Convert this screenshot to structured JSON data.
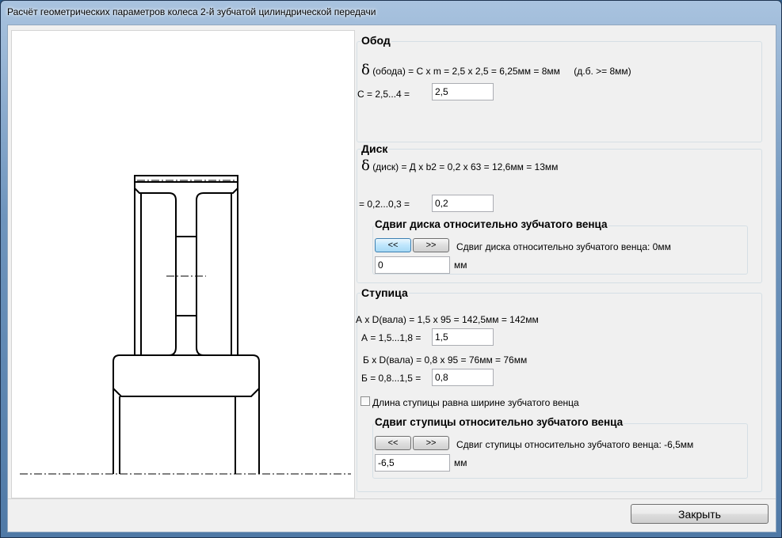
{
  "window": {
    "title": "Расчёт геометрических параметров колеса 2-й зубчатой цилиндрической передачи"
  },
  "rim": {
    "title": "Обод",
    "delta_symbol": "δ",
    "formula": "(обода) = С х m = 2,5 х 2,5 = 6,25мм = 8мм",
    "note": "(д.б. >= 8мм)",
    "c_label": "С = 2,5...4 =",
    "c_value": "2,5"
  },
  "disc": {
    "title": "Диск",
    "delta_symbol": "δ",
    "formula": "(диск) = Д х b2 = 0,2 х 63 = 12,6мм = 13мм",
    "d_label": "= 0,2...0,3 =",
    "d_value": "0,2",
    "shift": {
      "title": "Сдвиг диска относительно зубчатого венца",
      "btn_left": "<<",
      "btn_right": ">>",
      "status": "Сдвиг диска относительно зубчатого венца: 0мм",
      "value": "0",
      "unit": "мм"
    }
  },
  "hub": {
    "title": "Ступица",
    "formula_a": "А х D(вала) = 1,5 х 95 = 142,5мм = 142мм",
    "a_label": "А = 1,5...1,8 =",
    "a_value": "1,5",
    "formula_b": "Б х D(вала) = 0,8 х 95 = 76мм = 76мм",
    "b_label": "Б = 0,8...1,5 =",
    "b_value": "0,8",
    "checkbox_label": "Длина ступицы равна ширине зубчатого венца",
    "checkbox_checked": false,
    "shift": {
      "title": "Сдвиг ступицы относительно зубчатого венца",
      "btn_left": "<<",
      "btn_right": ">>",
      "status": "Сдвиг ступицы относительно зубчатого венца: -6,5мм",
      "value": "-6,5",
      "unit": "мм"
    }
  },
  "footer": {
    "close_label": "Закрыть"
  }
}
